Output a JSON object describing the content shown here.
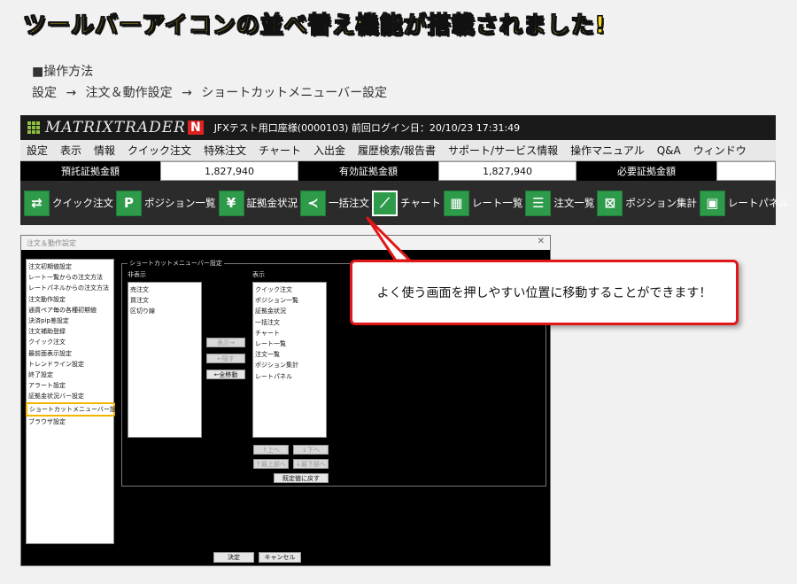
{
  "headline": "ツールバーアイコンの並べ替え機能が搭載されました!",
  "howto": {
    "title": "■操作方法",
    "steps": "設定 → 注文＆動作設定 → ショートカットメニューバー設定"
  },
  "app": {
    "brand": "MATRIXTRADER",
    "brand_mark": "N",
    "account_info": "JFXテスト用口座様(0000103)  前回ログイン日：20/10/23  17:31:49",
    "menu": [
      "設定",
      "表示",
      "情報",
      "クイック注文",
      "特殊注文",
      "チャート",
      "入出金",
      "履歴検索/報告書",
      "サポート/サービス情報",
      "操作マニュアル",
      "Q&A",
      "ウィンドウ"
    ],
    "balance": {
      "deposit_label": "預託証拠金額",
      "deposit_value": "1,827,940",
      "effective_label": "有効証拠金額",
      "effective_value": "1,827,940",
      "required_label": "必要証拠金額",
      "required_value": ""
    },
    "toolbar": [
      {
        "icon": "quick-order-icon",
        "glyph": "⇄",
        "label": "クイック注文"
      },
      {
        "icon": "position-icon",
        "glyph": "P",
        "label": "ポジション一覧"
      },
      {
        "icon": "yen-icon",
        "glyph": "¥",
        "label": "証拠金状況"
      },
      {
        "icon": "bulk-order-icon",
        "glyph": "≺",
        "label": "一括注文"
      },
      {
        "icon": "chart-icon",
        "glyph": "⟋",
        "label": "チャート"
      },
      {
        "icon": "rate-list-icon",
        "glyph": "▦",
        "label": "レート一覧"
      },
      {
        "icon": "order-list-icon",
        "glyph": "☰",
        "label": "注文一覧"
      },
      {
        "icon": "position-summary-icon",
        "glyph": "⊠",
        "label": "ポジション集計"
      },
      {
        "icon": "rate-panel-icon",
        "glyph": "▣",
        "label": "レートパネル"
      }
    ]
  },
  "dialog": {
    "title": "注文＆動作設定",
    "nav": [
      "注文初期値設定",
      "レート一覧からの注文方法",
      "レートパネルからの注文方法",
      "注文動作設定",
      "通貨ペア毎の各種初期値",
      "決済pip差設定",
      "注文補助登録",
      "クイック注文",
      "最前面表示設定",
      "トレンドライン設定",
      "終了設定",
      "アラート設定",
      "証拠金状況バー設定",
      "ショートカットメニューバー設定",
      "ブラウザ設定"
    ],
    "nav_selected": "ショートカットメニューバー設定",
    "group_title": "ショートカットメニューバー設定",
    "hidden_header": "非表示",
    "hidden_items": [
      "売注文",
      "買注文",
      "区切り線"
    ],
    "shown_header": "表示",
    "shown_items": [
      "クイック注文",
      "ポジション一覧",
      "証拠金状況",
      "一括注文",
      "チャート",
      "レート一覧",
      "注文一覧",
      "ポジション集計",
      "レートパネル"
    ],
    "btn_show": "表示→",
    "btn_hide": "←隠す",
    "btn_move_all": "←全移動",
    "btn_up": "↑上へ",
    "btn_down": "↓下へ",
    "btn_top": "↑最上部へ",
    "btn_bottom": "↓最下部へ",
    "btn_default": "既定値に戻す",
    "btn_ok": "決定",
    "btn_cancel": "キャンセル"
  },
  "callout": "よく使う画面を押しやすい位置に移動することができます！",
  "colors": {
    "headline": "#f7d81c",
    "callout_border": "#e01717",
    "tool_icon": "#2e9b4a",
    "highlight": "#f5b400"
  }
}
